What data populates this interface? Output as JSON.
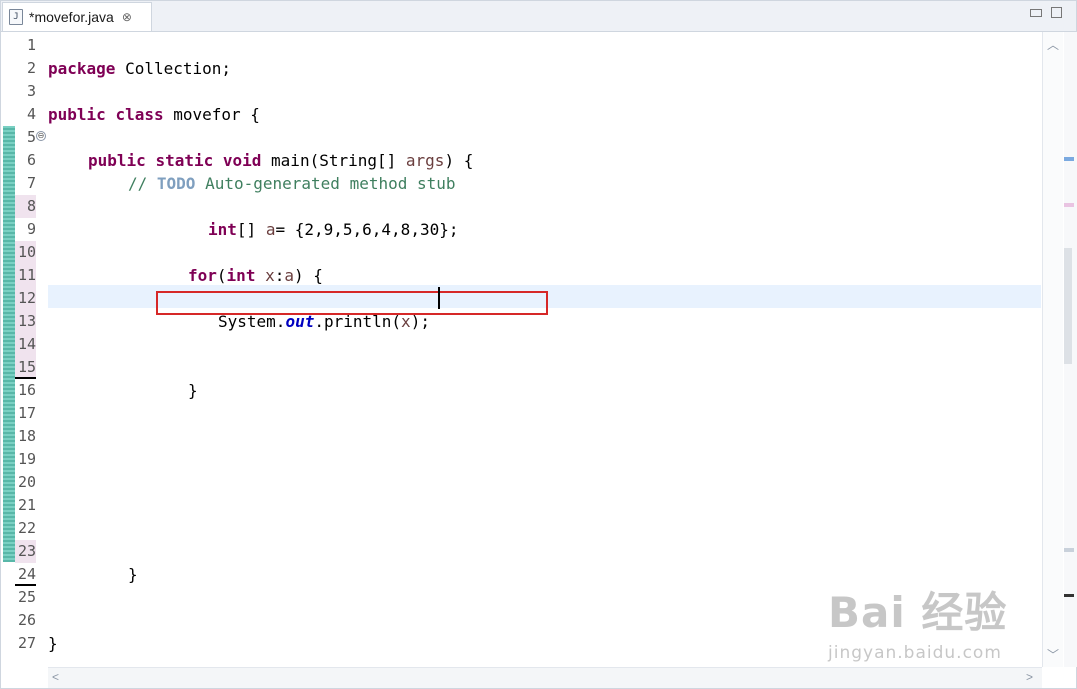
{
  "tab": {
    "title": "*movefor.java",
    "icon_label": "J",
    "close_glyph": "⊗"
  },
  "editor": {
    "lines": [
      {
        "num": "1"
      },
      {
        "num": "2"
      },
      {
        "num": "3"
      },
      {
        "num": "4"
      },
      {
        "num": "5"
      },
      {
        "num": "6"
      },
      {
        "num": "7"
      },
      {
        "num": "8"
      },
      {
        "num": "9"
      },
      {
        "num": "10"
      },
      {
        "num": "11"
      },
      {
        "num": "12"
      },
      {
        "num": "13"
      },
      {
        "num": "14"
      },
      {
        "num": "15"
      },
      {
        "num": "16"
      },
      {
        "num": "17"
      },
      {
        "num": "18"
      },
      {
        "num": "19"
      },
      {
        "num": "20"
      },
      {
        "num": "21"
      },
      {
        "num": "22"
      },
      {
        "num": "23"
      },
      {
        "num": "24"
      },
      {
        "num": "25"
      },
      {
        "num": "26"
      },
      {
        "num": "27"
      }
    ],
    "code": {
      "l1_kw": "package",
      "l1_rest": " Collection;",
      "l3_kw1": "public",
      "l3_kw2": "class",
      "l3_rest": " movefor {",
      "l5_kw1": "public",
      "l5_kw2": "static",
      "l5_kw3": "void",
      "l5_rest": " main(String[] ",
      "l5_var": "args",
      "l5_end": ") {",
      "l6_c1": "// ",
      "l6_todo": "TODO",
      "l6_c2": " Auto-generated method stub",
      "l8_kw": "int",
      "l8_a": "[] ",
      "l8_var": "a",
      "l8_rest": "= {2,9,5,6,4,8,30};",
      "l10_kw1": "for",
      "l10_p": "(",
      "l10_kw2": "int",
      "l10_sp": " ",
      "l10_var": "x",
      "l10_c": ":",
      "l10_var2": "a",
      "l10_end": ") {",
      "l12_a": "System.",
      "l12_fld": "out",
      "l12_b": ".println(",
      "l12_var": "x",
      "l12_c": ");",
      "l15": "}",
      "l23": "}",
      "l26": "}"
    },
    "fold_glyph": "⊖"
  },
  "watermark": {
    "logo": "Bai 经验",
    "site": "jingyan.baidu.com"
  },
  "colors": {
    "keyword": "#7f0055",
    "comment": "#3f7f5f",
    "field": "#0000c0",
    "highlight": "#d62828"
  }
}
